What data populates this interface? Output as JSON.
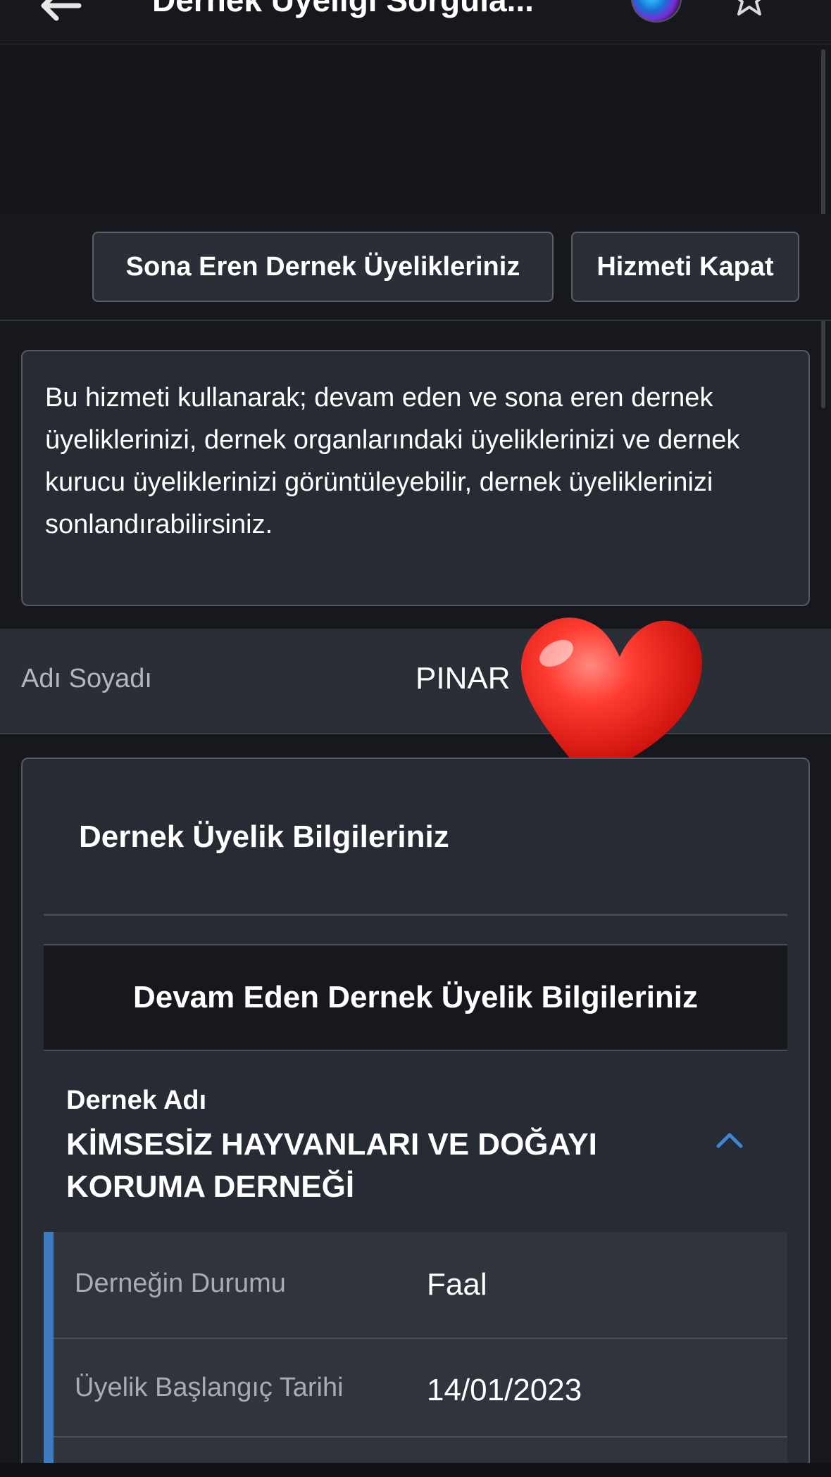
{
  "header": {
    "title": "Dernek Üyeliği Sorgula..."
  },
  "toolbar": {
    "expired_memberships_label": "Sona Eren Dernek Üyelikleriniz",
    "close_service_label": "Hizmeti Kapat"
  },
  "info": {
    "description": "Bu hizmeti kullanarak; devam eden ve sona eren dernek üyeliklerinizi, dernek organlarındaki üyeliklerinizi ve dernek kurucu üyeliklerinizi görüntüleyebilir, dernek üyeliklerinizi sonlandırabilirsiniz."
  },
  "person": {
    "name_label": "Adı Soyadı",
    "name_value": "PINAR"
  },
  "card": {
    "title": "Dernek Üyelik Bilgileriniz",
    "section_title": "Devam Eden Dernek Üyelik Bilgileriniz",
    "association_label": "Dernek Adı",
    "association_name": "KİMSESİZ HAYVANLARI VE DOĞAYI KORUMA DERNEĞİ",
    "details": [
      {
        "label": "Derneğin Durumu",
        "value": "Faal"
      },
      {
        "label": "Üyelik Başlangıç Tarihi",
        "value": "14/01/2023"
      }
    ]
  },
  "colors": {
    "background": "#16181d",
    "card": "#272b33",
    "accent": "#3c7cc2",
    "heart": "#e8231f"
  },
  "icons": [
    "back-arrow-icon",
    "siri-icon",
    "star-icon",
    "heart-icon",
    "chevron-up-icon"
  ]
}
